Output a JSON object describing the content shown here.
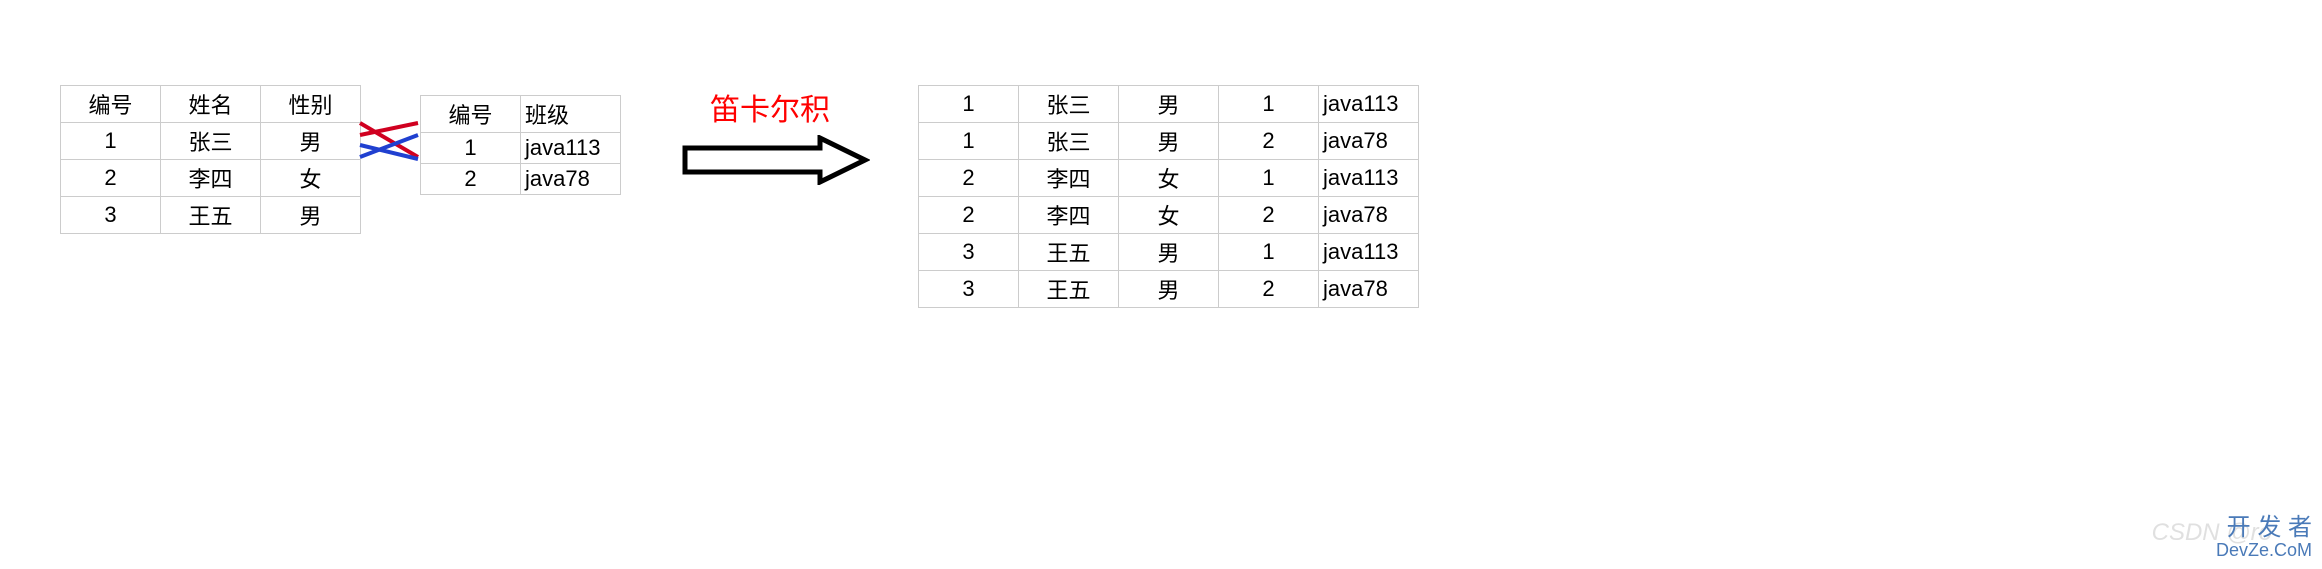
{
  "title": "笛卡尔积",
  "table1": {
    "headers": [
      "编号",
      "姓名",
      "性别"
    ],
    "rows": [
      [
        "1",
        "张三",
        "男"
      ],
      [
        "2",
        "李四",
        "女"
      ],
      [
        "3",
        "王五",
        "男"
      ]
    ]
  },
  "table2": {
    "headers": [
      "编号",
      "班级"
    ],
    "rows": [
      [
        "1",
        "java113"
      ],
      [
        "2",
        "java78"
      ]
    ]
  },
  "table3": {
    "rows": [
      [
        "1",
        "张三",
        "男",
        "1",
        "java113"
      ],
      [
        "1",
        "张三",
        "男",
        "2",
        "java78"
      ],
      [
        "2",
        "李四",
        "女",
        "1",
        "java113"
      ],
      [
        "2",
        "李四",
        "女",
        "2",
        "java78"
      ],
      [
        "3",
        "王五",
        "男",
        "1",
        "java113"
      ],
      [
        "3",
        "王五",
        "男",
        "2",
        "java78"
      ]
    ]
  },
  "watermark_csdn": "CSDN @ro",
  "watermark_cn": "开 发 者",
  "watermark_en": "DevZe.CoM"
}
